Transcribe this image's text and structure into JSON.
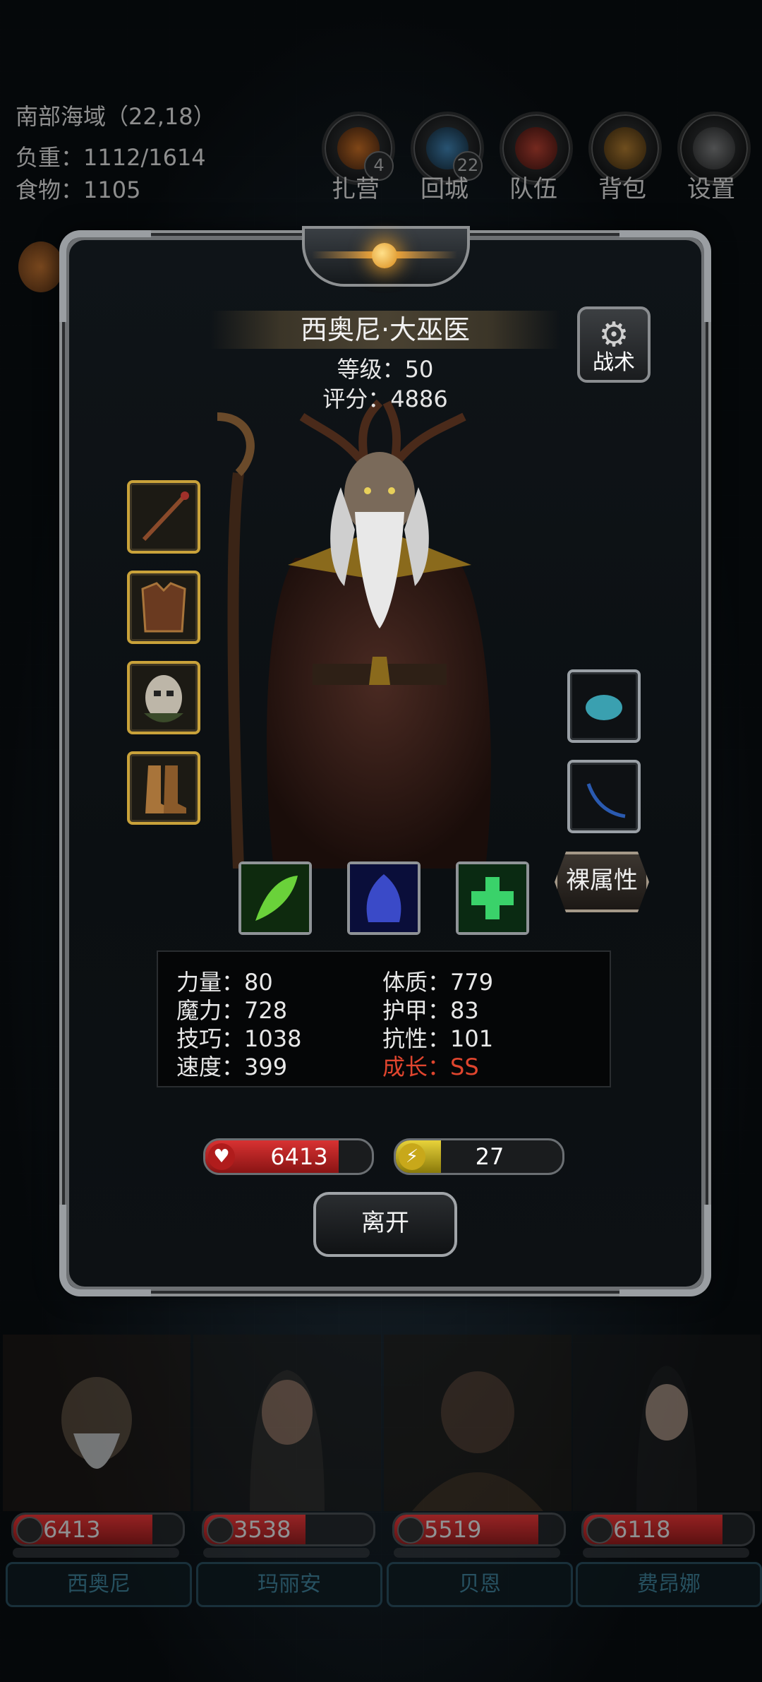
{
  "hud": {
    "location": "南部海域（22,18）",
    "weight": "负重：1112/1614",
    "food": "食物：1105"
  },
  "top_menu": [
    {
      "label": "扎营",
      "badge": "4",
      "icon": "campfire-icon"
    },
    {
      "label": "回城",
      "badge": "22",
      "icon": "portal-icon"
    },
    {
      "label": "队伍",
      "badge": "",
      "icon": "team-icon"
    },
    {
      "label": "背包",
      "badge": "",
      "icon": "barrel-icon"
    },
    {
      "label": "设置",
      "badge": "",
      "icon": "gear-icon"
    }
  ],
  "hero": {
    "name": "西奥尼·大巫医",
    "level": "等级：50",
    "score": "评分：4886",
    "tactics_label": "战术",
    "naked_attr_label": "裸属性",
    "equipment_left": [
      "staff-icon",
      "armor-icon",
      "mask-icon",
      "boots-icon"
    ],
    "equipment_right": [
      "gem-icon",
      "whip-icon"
    ],
    "skills": [
      "green-leaf-skill-icon",
      "blue-spirit-skill-icon",
      "green-cross-skill-icon"
    ],
    "stats_left": [
      "力量：80",
      "魔力：728",
      "技巧：1038",
      "速度：399"
    ],
    "stats_right": [
      "体质：779",
      "护甲：83",
      "抗性：101"
    ],
    "growth": "成长：SS",
    "hp": "6413",
    "hp_fraction": 0.8,
    "energy": "27",
    "energy_fraction": 0.27,
    "leave_label": "离开"
  },
  "party": [
    {
      "name": "西奥尼",
      "hp": "6413",
      "hp_fraction": 0.82
    },
    {
      "name": "玛丽安",
      "hp": "3538",
      "hp_fraction": 0.6
    },
    {
      "name": "贝恩",
      "hp": "5519",
      "hp_fraction": 0.85
    },
    {
      "name": "费昂娜",
      "hp": "6118",
      "hp_fraction": 0.82
    }
  ],
  "colors": {
    "gold_slot": "#c9a23a",
    "growth": "#e0452e",
    "hp": "#c52a2a",
    "energy": "#d8c21a"
  }
}
